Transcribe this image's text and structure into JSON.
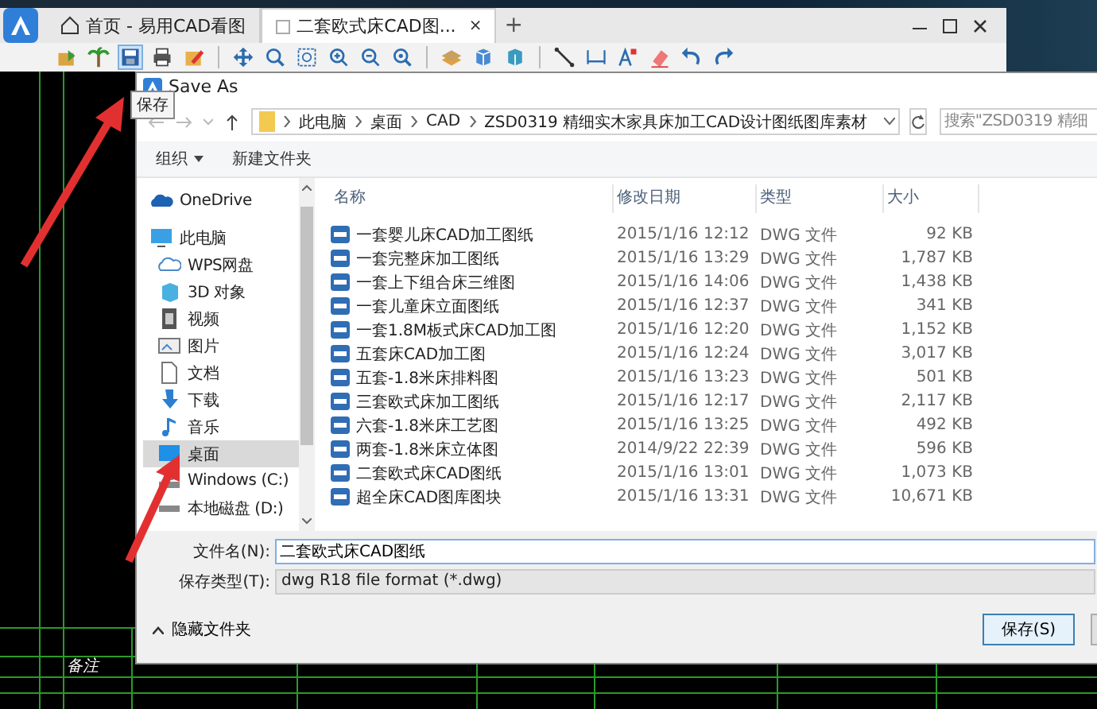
{
  "app": {
    "tabs": [
      {
        "label": "首页 - 易用CAD看图",
        "selected": false
      },
      {
        "label": "二套欧式床CAD图...",
        "selected": true,
        "close": "×"
      }
    ],
    "new_tab": "+",
    "tooltip": "保存"
  },
  "canvas": {
    "note_label": "备注"
  },
  "dialog": {
    "title": "Save As",
    "breadcrumb": [
      "此电脑",
      "桌面",
      "CAD",
      "ZSD0319 精细实木家具床加工CAD设计图纸图库素材"
    ],
    "search": {
      "placeholder": "搜索\"ZSD0319 精细"
    },
    "commands": [
      {
        "label": "组织",
        "dropdown": true
      },
      {
        "label": "新建文件夹",
        "dropdown": false
      }
    ],
    "nav": [
      {
        "label": "OneDrive",
        "kind": "onedrive",
        "selected": false
      },
      {
        "label": "此电脑",
        "kind": "pc",
        "selected": false,
        "children": [
          {
            "label": "WPS网盘",
            "kind": "wps",
            "selected": false
          },
          {
            "label": "3D 对象",
            "kind": "cube",
            "selected": false
          },
          {
            "label": "视频",
            "kind": "video",
            "selected": false
          },
          {
            "label": "图片",
            "kind": "picture",
            "selected": false
          },
          {
            "label": "文档",
            "kind": "document",
            "selected": false
          },
          {
            "label": "下载",
            "kind": "download",
            "selected": false
          },
          {
            "label": "音乐",
            "kind": "music",
            "selected": false
          },
          {
            "label": "桌面",
            "kind": "desktop",
            "selected": true
          },
          {
            "label": "Windows (C:)",
            "kind": "windows-drive",
            "selected": false
          },
          {
            "label": "本地磁盘 (D:)",
            "kind": "drive",
            "selected": false
          }
        ]
      }
    ],
    "columns": [
      "名称",
      "修改日期",
      "类型",
      "大小"
    ],
    "rows": [
      {
        "name": "一套婴儿床CAD加工图纸",
        "date": "2015/1/16 12:12",
        "type": "DWG 文件",
        "size": "92 KB"
      },
      {
        "name": "一套完整床加工图纸",
        "date": "2015/1/16 13:29",
        "type": "DWG 文件",
        "size": "1,787 KB"
      },
      {
        "name": "一套上下组合床三维图",
        "date": "2015/1/16 14:06",
        "type": "DWG 文件",
        "size": "1,438 KB"
      },
      {
        "name": "一套儿童床立面图纸",
        "date": "2015/1/16 12:37",
        "type": "DWG 文件",
        "size": "341 KB"
      },
      {
        "name": "一套1.8M板式床CAD加工图",
        "date": "2015/1/16 12:20",
        "type": "DWG 文件",
        "size": "1,152 KB"
      },
      {
        "name": "五套床CAD加工图",
        "date": "2015/1/16 12:24",
        "type": "DWG 文件",
        "size": "3,017 KB"
      },
      {
        "name": "五套-1.8米床排料图",
        "date": "2015/1/16 13:23",
        "type": "DWG 文件",
        "size": "501 KB"
      },
      {
        "name": "三套欧式床加工图纸",
        "date": "2015/1/16 12:17",
        "type": "DWG 文件",
        "size": "2,117 KB"
      },
      {
        "name": "六套-1.8米床工艺图",
        "date": "2015/1/16 13:25",
        "type": "DWG 文件",
        "size": "492 KB"
      },
      {
        "name": "两套-1.8米床立体图",
        "date": "2014/9/22 22:39",
        "type": "DWG 文件",
        "size": "596 KB"
      },
      {
        "name": "二套欧式床CAD图纸",
        "date": "2015/1/16 13:01",
        "type": "DWG 文件",
        "size": "1,073 KB"
      },
      {
        "name": "超全床CAD图库图块",
        "date": "2015/1/16 13:31",
        "type": "DWG 文件",
        "size": "10,671 KB"
      }
    ],
    "file_name_label": "文件名(N):",
    "file_name": "二套欧式床CAD图纸",
    "save_type_label": "保存类型(T):",
    "save_type": "dwg R18 file format (*.dwg)",
    "hide_folders": "隐藏文件夹",
    "save_button": "保存(S)"
  }
}
